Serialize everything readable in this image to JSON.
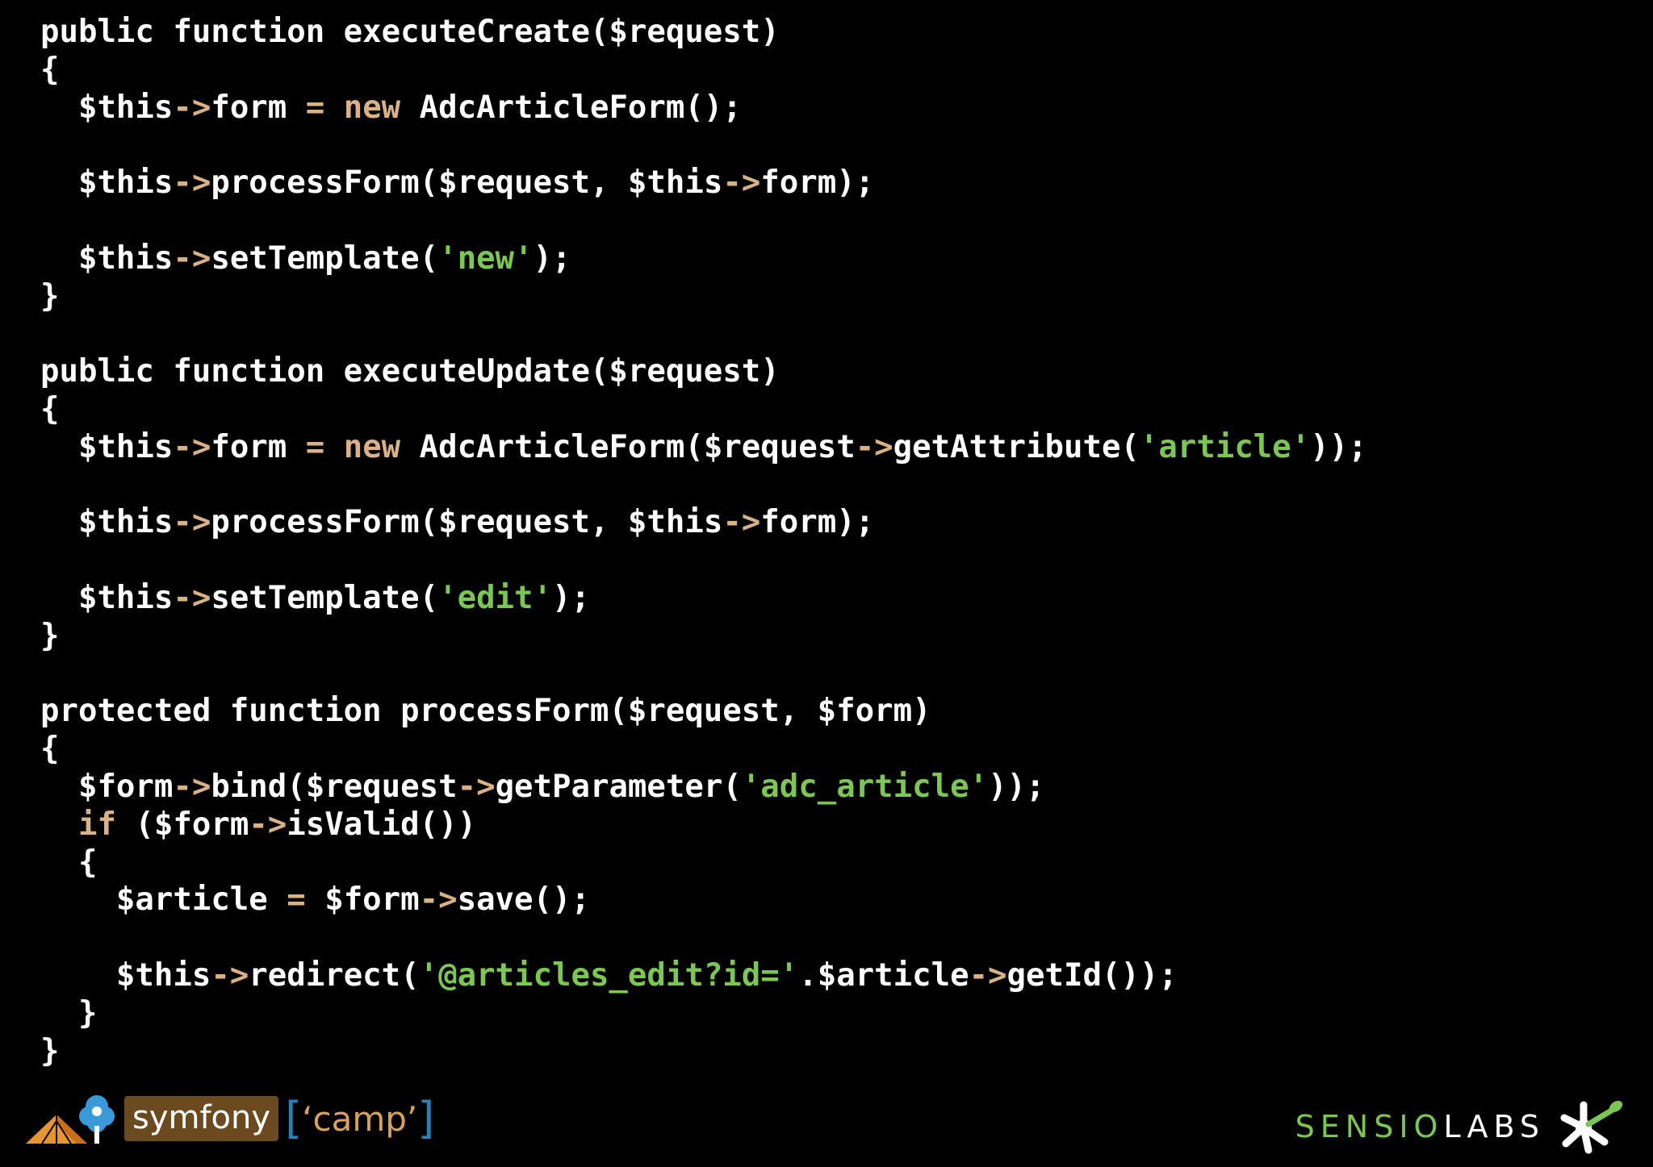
{
  "code": {
    "language": "php",
    "lines": [
      [
        {
          "t": "public function executeCreate($request)",
          "c": "plain"
        }
      ],
      [
        {
          "t": "{",
          "c": "plain"
        }
      ],
      [
        {
          "t": "  $this",
          "c": "plain"
        },
        {
          "t": "->",
          "c": "operator"
        },
        {
          "t": "form ",
          "c": "plain"
        },
        {
          "t": "=",
          "c": "operator"
        },
        {
          "t": " ",
          "c": "plain"
        },
        {
          "t": "new",
          "c": "keyword2"
        },
        {
          "t": " AdcArticleForm();",
          "c": "plain"
        }
      ],
      [],
      [
        {
          "t": "  $this",
          "c": "plain"
        },
        {
          "t": "->",
          "c": "operator"
        },
        {
          "t": "processForm($request, $this",
          "c": "plain"
        },
        {
          "t": "->",
          "c": "operator"
        },
        {
          "t": "form);",
          "c": "plain"
        }
      ],
      [],
      [
        {
          "t": "  $this",
          "c": "plain"
        },
        {
          "t": "->",
          "c": "operator"
        },
        {
          "t": "setTemplate(",
          "c": "plain"
        },
        {
          "t": "'new'",
          "c": "string"
        },
        {
          "t": ");",
          "c": "plain"
        }
      ],
      [
        {
          "t": "}",
          "c": "plain"
        }
      ],
      [],
      [
        {
          "t": "public function executeUpdate($request)",
          "c": "plain"
        }
      ],
      [
        {
          "t": "{",
          "c": "plain"
        }
      ],
      [
        {
          "t": "  $this",
          "c": "plain"
        },
        {
          "t": "->",
          "c": "operator"
        },
        {
          "t": "form ",
          "c": "plain"
        },
        {
          "t": "=",
          "c": "operator"
        },
        {
          "t": " ",
          "c": "plain"
        },
        {
          "t": "new",
          "c": "keyword2"
        },
        {
          "t": " AdcArticleForm($request",
          "c": "plain"
        },
        {
          "t": "->",
          "c": "operator"
        },
        {
          "t": "getAttribute(",
          "c": "plain"
        },
        {
          "t": "'article'",
          "c": "string"
        },
        {
          "t": "));",
          "c": "plain"
        }
      ],
      [],
      [
        {
          "t": "  $this",
          "c": "plain"
        },
        {
          "t": "->",
          "c": "operator"
        },
        {
          "t": "processForm($request, $this",
          "c": "plain"
        },
        {
          "t": "->",
          "c": "operator"
        },
        {
          "t": "form);",
          "c": "plain"
        }
      ],
      [],
      [
        {
          "t": "  $this",
          "c": "plain"
        },
        {
          "t": "->",
          "c": "operator"
        },
        {
          "t": "setTemplate(",
          "c": "plain"
        },
        {
          "t": "'edit'",
          "c": "string"
        },
        {
          "t": ");",
          "c": "plain"
        }
      ],
      [
        {
          "t": "}",
          "c": "plain"
        }
      ],
      [],
      [
        {
          "t": "protected function processForm($request, $form)",
          "c": "plain"
        }
      ],
      [
        {
          "t": "{",
          "c": "plain"
        }
      ],
      [
        {
          "t": "  $form",
          "c": "plain"
        },
        {
          "t": "->",
          "c": "operator"
        },
        {
          "t": "bind($request",
          "c": "plain"
        },
        {
          "t": "->",
          "c": "operator"
        },
        {
          "t": "getParameter(",
          "c": "plain"
        },
        {
          "t": "'adc_article'",
          "c": "string"
        },
        {
          "t": "));",
          "c": "plain"
        }
      ],
      [
        {
          "t": "  ",
          "c": "plain"
        },
        {
          "t": "if",
          "c": "keyword2"
        },
        {
          "t": " ($form",
          "c": "plain"
        },
        {
          "t": "->",
          "c": "operator"
        },
        {
          "t": "isValid())",
          "c": "plain"
        }
      ],
      [
        {
          "t": "  {",
          "c": "plain"
        }
      ],
      [
        {
          "t": "    $article ",
          "c": "plain"
        },
        {
          "t": "=",
          "c": "operator"
        },
        {
          "t": " $form",
          "c": "plain"
        },
        {
          "t": "->",
          "c": "operator"
        },
        {
          "t": "save();",
          "c": "plain"
        }
      ],
      [],
      [
        {
          "t": "    $this",
          "c": "plain"
        },
        {
          "t": "->",
          "c": "operator"
        },
        {
          "t": "redirect(",
          "c": "plain"
        },
        {
          "t": "'@articles_edit?id='",
          "c": "string"
        },
        {
          "t": ".$article",
          "c": "plain"
        },
        {
          "t": "->",
          "c": "operator"
        },
        {
          "t": "getId());",
          "c": "plain"
        }
      ],
      [
        {
          "t": "  }",
          "c": "plain"
        }
      ],
      [
        {
          "t": "}",
          "c": "plain"
        }
      ]
    ]
  },
  "footer": {
    "left": {
      "brand": "symfony",
      "bracket_open": "[",
      "camp": "‘camp’",
      "bracket_close": "]",
      "tent_icon": "tent-logo-icon",
      "colors": {
        "tent": "#e8952e",
        "tree": "#3a9ad9",
        "badge": "#6b4a1f",
        "camp": "#d9a257",
        "brackets": "#2a7fb8"
      }
    },
    "right": {
      "sensio": "SENSIO",
      "labs": "LABS",
      "mark_icon": "sensiolabs-asterisk-icon",
      "colors": {
        "sensio": "#7cc653",
        "labs": "#ffffff",
        "leaf": "#7cc653"
      }
    }
  },
  "colors": {
    "background": "#000000",
    "text": "#ffffff",
    "keyword": "#d9b184",
    "operator": "#d9b184",
    "string": "#7cc653"
  }
}
